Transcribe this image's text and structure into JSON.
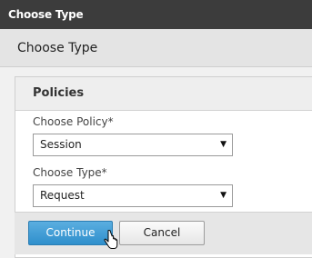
{
  "window": {
    "title": "Choose Type"
  },
  "page": {
    "heading": "Choose Type"
  },
  "panel": {
    "title": "Policies",
    "fields": [
      {
        "label": "Choose Policy*",
        "value": "Session"
      },
      {
        "label": "Choose Type*",
        "value": "Request"
      }
    ]
  },
  "actions": {
    "continue_label": "Continue",
    "cancel_label": "Cancel"
  },
  "icons": {
    "dropdown": "chevron-down-icon",
    "cursor": "hand-pointer-icon"
  }
}
